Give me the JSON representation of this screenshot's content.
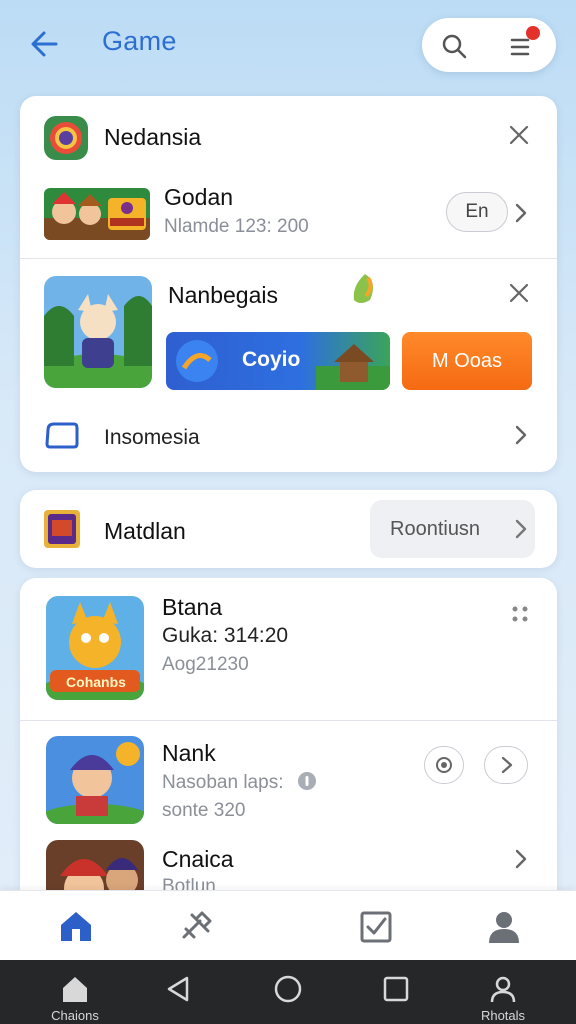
{
  "header": {
    "title": "Game",
    "back_icon": "arrow-left-icon",
    "search_icon": "search-icon",
    "menu_icon": "filter-menu-icon",
    "notification_color": "#e5312c"
  },
  "card1": {
    "row1": {
      "title": "Nedansia"
    },
    "row2": {
      "title": "Godan",
      "subtitle": "Nlamde 123: 200",
      "button": "En"
    },
    "row3": {
      "title": "Nanbegais",
      "banner_left": "Coyio",
      "banner_right": "M Ooas"
    },
    "row4": {
      "title": "Insomesia"
    }
  },
  "card2": {
    "title": "Matdlan",
    "button": "Roontiusn"
  },
  "list": [
    {
      "title": "Btana",
      "line1": "Guka: 314:20",
      "line2": "Aog21230",
      "thumb_text": "Cohanbs"
    },
    {
      "title": "Nank",
      "line1": "Nasoban laps:",
      "line2": "sonte 320"
    },
    {
      "title": "Cnaica",
      "line1": "Botlun"
    }
  ],
  "bottom_nav": {
    "items": [
      "home-icon",
      "tools-icon",
      "checklist-icon",
      "profile-icon"
    ],
    "active_color": "#2d5fc8"
  },
  "system_bar": {
    "left_label": "Chaions",
    "right_label": "Rhotals"
  }
}
